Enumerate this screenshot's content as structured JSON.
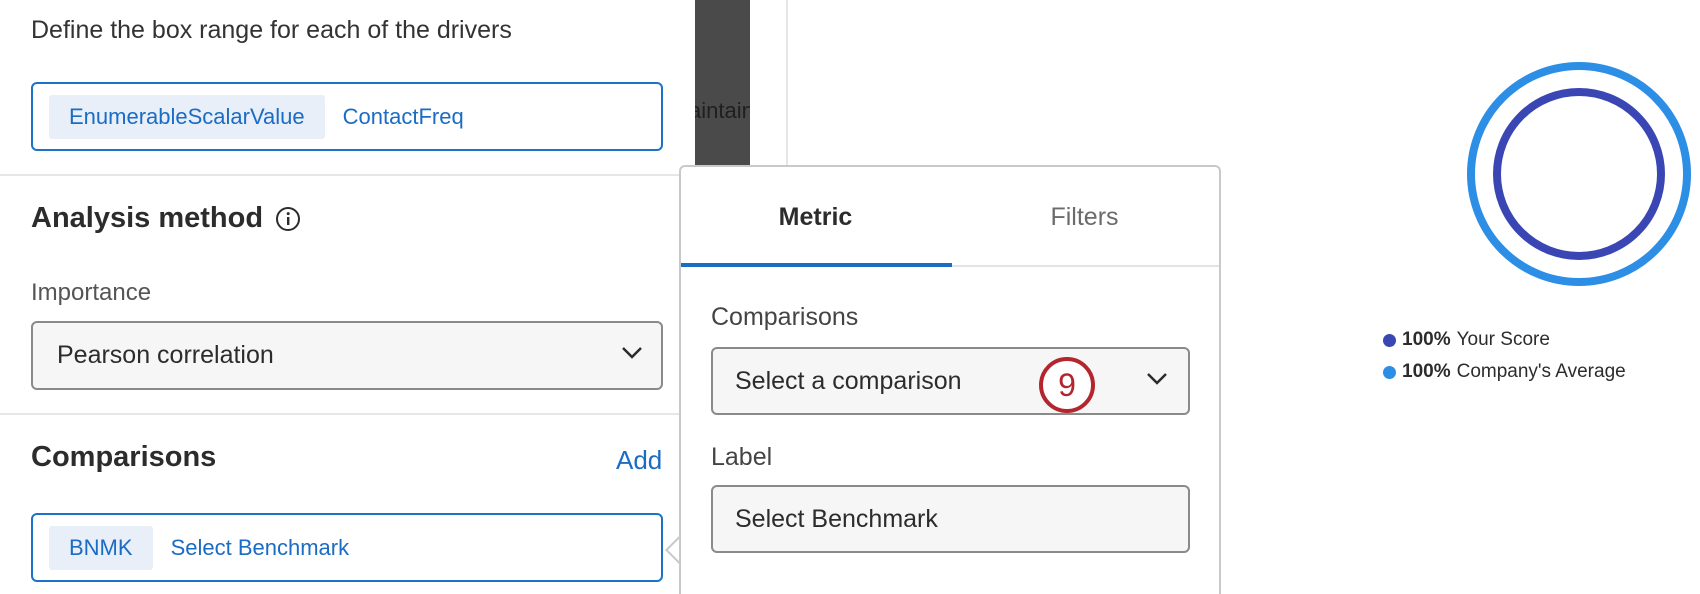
{
  "left_panel": {
    "instructions": "Define the box range for each of the drivers",
    "drivers_field": {
      "key": "EnumerableScalarValue",
      "value": "ContactFreq"
    },
    "analysis_method": {
      "heading": "Analysis method",
      "info_icon": "info-circle-icon",
      "importance_label": "Importance",
      "importance_value": "Pearson correlation"
    },
    "comparisons": {
      "heading": "Comparisons",
      "add_label": "Add",
      "item": {
        "key": "BNMK",
        "value": "Select Benchmark"
      }
    }
  },
  "background": {
    "clipped_text": "aintain"
  },
  "popover": {
    "tabs": [
      {
        "label": "Metric",
        "active": true
      },
      {
        "label": "Filters",
        "active": false
      }
    ],
    "comparisons_label": "Comparisons",
    "comparisons_select": "Select a comparison",
    "step_marker": "9",
    "label_label": "Label",
    "label_value": "Select Benchmark"
  },
  "preview": {
    "icons": {
      "chevron": "chevron-down-icon"
    },
    "colors": {
      "your_score": "#3a46b4",
      "company_average": "#2d8ee6",
      "accent": "#1a6cc4",
      "marker": "#b3262d"
    },
    "legend": [
      {
        "value": "100%",
        "label": "Your Score",
        "fraction": 1.0
      },
      {
        "value": "100%",
        "label": "Company's Average",
        "fraction": 1.0
      }
    ]
  }
}
